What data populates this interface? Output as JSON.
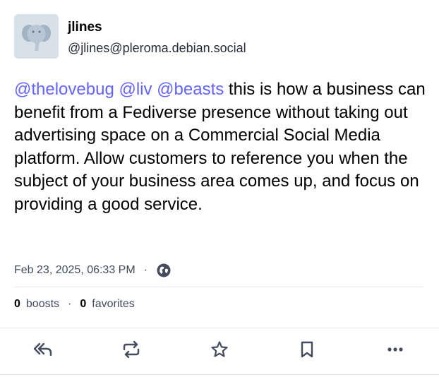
{
  "post": {
    "display_name": "jlines",
    "handle": "@jlines@pleroma.debian.social",
    "mentions": [
      "@thelovebug",
      "@liv",
      "@beasts"
    ],
    "body": "this is how a business can benefit from a Fediverse presence without taking out advertising space on a Commercial Social Media platform. Allow customers to reference you when the subject of your business area comes up, and focus on providing a good service.",
    "timestamp": "Feb 23, 2025, 06:33 PM",
    "visibility_icon": "globe-icon",
    "boosts_count": "0",
    "boosts_label": "boosts",
    "favorites_count": "0",
    "favorites_label": "favorites"
  },
  "actions": [
    "reply-all-icon",
    "boost-icon",
    "star-icon",
    "bookmark-icon",
    "more-icon"
  ],
  "colors": {
    "mention": "#6364ff",
    "icon": "#444b5d",
    "muted_text": "#444b5d",
    "avatar_bg": "#d9e1e8"
  }
}
